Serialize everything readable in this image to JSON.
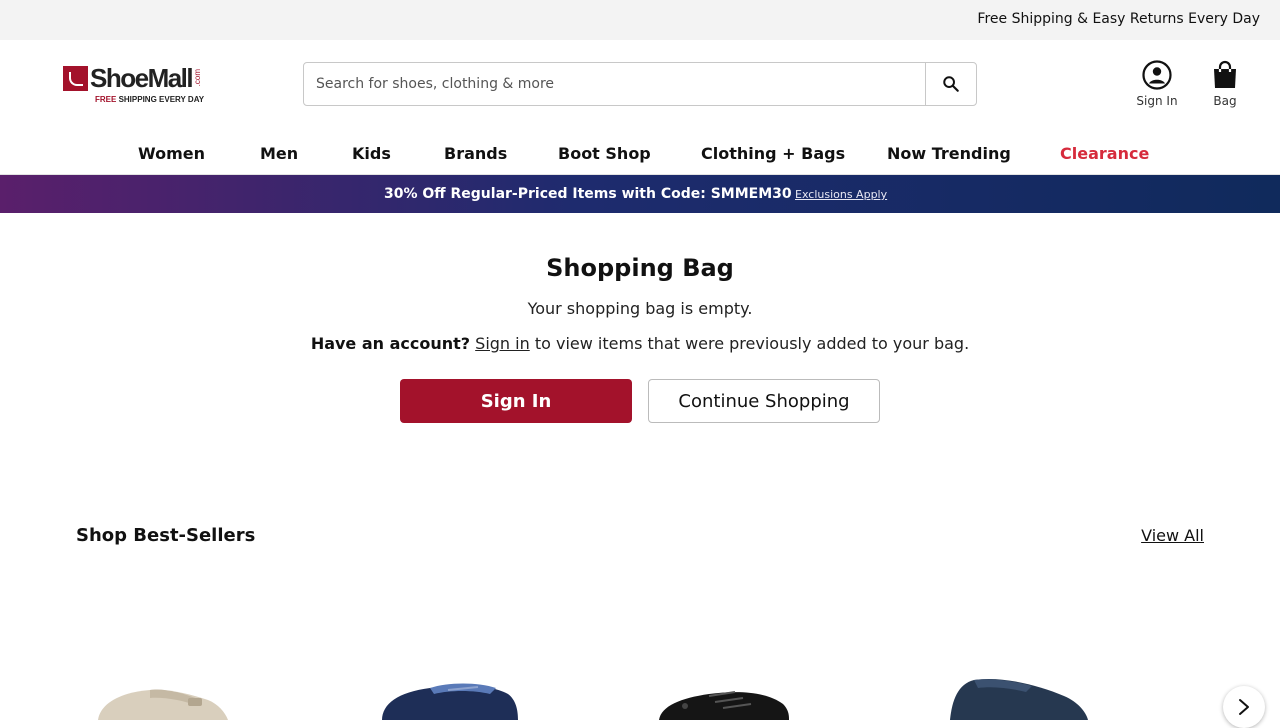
{
  "topbar": {
    "message": "Free Shipping & Easy Returns Every Day"
  },
  "logo": {
    "name": "ShoeMall",
    "suffix": ".com",
    "tagline_free": "FREE",
    "tagline_rest": " SHIPPING EVERY DAY"
  },
  "search": {
    "placeholder": "Search for shoes, clothing & more",
    "value": ""
  },
  "header": {
    "sign_in_label": "Sign In",
    "bag_label": "Bag"
  },
  "nav": {
    "items": [
      "Women",
      "Men",
      "Kids",
      "Brands",
      "Boot Shop",
      "Clothing + Bags",
      "Now Trending",
      "Clearance"
    ]
  },
  "promo": {
    "text": "30% Off Regular-Priced Items with Code: SMMEM30",
    "link": "Exclusions Apply"
  },
  "bag": {
    "title": "Shopping Bag",
    "empty_message": "Your shopping bag is empty.",
    "account_prompt": "Have an account?",
    "sign_in_link": "Sign in",
    "account_suffix": " to view items that were previously added to your bag.",
    "sign_in_button": "Sign In",
    "continue_button": "Continue Shopping"
  },
  "bestsellers": {
    "title": "Shop Best-Sellers",
    "view_all": "View All"
  },
  "colors": {
    "brand": "#a3122b",
    "clearance": "#d62b3c"
  }
}
